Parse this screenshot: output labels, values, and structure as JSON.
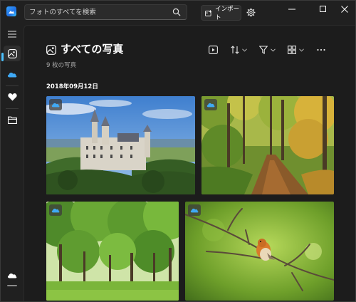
{
  "app": {
    "logo_icon": "photos-app-icon"
  },
  "titlebar": {
    "search_placeholder": "フォトのすべてを検索",
    "import_label": "インポート",
    "window_controls": [
      "minimize-icon",
      "maximize-icon",
      "close-icon"
    ]
  },
  "nav": {
    "items": [
      {
        "icon": "hamburger-menu-icon"
      },
      {
        "icon": "photos-gallery-icon",
        "active": true
      },
      {
        "icon": "onedrive-cloud-icon"
      },
      {
        "icon": "heart-icon"
      },
      {
        "icon": "folder-icon"
      },
      {
        "icon": "cloud-storage-icon"
      }
    ]
  },
  "main": {
    "title": "すべての写真",
    "count": "9 枚の写真",
    "toolbar": [
      "slideshow-icon",
      "sort-icon",
      "filter-icon",
      "view-layout-icon",
      "more-options-icon"
    ],
    "date_heading": "2018年09月12日"
  },
  "photos": [
    {
      "subject": "castle",
      "cloud": true
    },
    {
      "subject": "forest-path",
      "cloud": true
    },
    {
      "subject": "green-trees",
      "cloud": true
    },
    {
      "subject": "robin-on-branch",
      "cloud": true
    }
  ],
  "colors": {
    "accent": "#4cc2ff",
    "background": "#1c1c1c",
    "onedrive": "#3fa9f5"
  }
}
